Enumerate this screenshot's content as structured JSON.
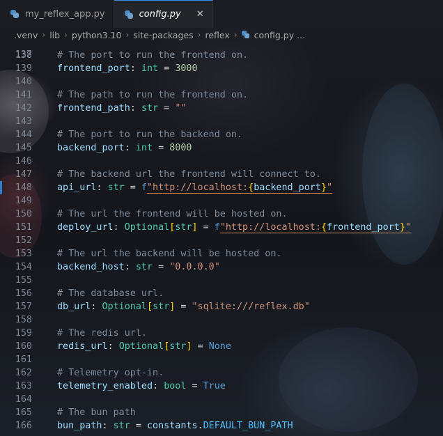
{
  "tabs": [
    {
      "label": "my_reflex_app.py",
      "active": false
    },
    {
      "label": "config.py",
      "active": true,
      "close": "✕"
    }
  ],
  "breadcrumb": {
    "segments": [
      ".venv",
      "lib",
      "python3.10",
      "site-packages",
      "reflex",
      "config.py",
      "..."
    ],
    "separator": "›"
  },
  "editor": {
    "partial_line_number": "137",
    "lines": [
      {
        "n": "138",
        "tokens": [
          {
            "t": "# The port to run the frontend on.",
            "c": "comment"
          }
        ]
      },
      {
        "n": "139",
        "tokens": [
          {
            "t": "frontend_port",
            "c": "var"
          },
          {
            "t": ": ",
            "c": "op"
          },
          {
            "t": "int",
            "c": "type"
          },
          {
            "t": " = ",
            "c": "op"
          },
          {
            "t": "3000",
            "c": "num"
          }
        ]
      },
      {
        "n": "140",
        "tokens": []
      },
      {
        "n": "141",
        "tokens": [
          {
            "t": "# The path to run the frontend on.",
            "c": "comment"
          }
        ]
      },
      {
        "n": "142",
        "tokens": [
          {
            "t": "frontend_path",
            "c": "var"
          },
          {
            "t": ": ",
            "c": "op"
          },
          {
            "t": "str",
            "c": "type"
          },
          {
            "t": " = ",
            "c": "op"
          },
          {
            "t": "\"\"",
            "c": "str"
          }
        ]
      },
      {
        "n": "143",
        "tokens": []
      },
      {
        "n": "144",
        "tokens": [
          {
            "t": "# The port to run the backend on.",
            "c": "comment"
          }
        ]
      },
      {
        "n": "145",
        "tokens": [
          {
            "t": "backend_port",
            "c": "var"
          },
          {
            "t": ": ",
            "c": "op"
          },
          {
            "t": "int",
            "c": "type"
          },
          {
            "t": " = ",
            "c": "op"
          },
          {
            "t": "8000",
            "c": "num"
          }
        ]
      },
      {
        "n": "146",
        "tokens": []
      },
      {
        "n": "147",
        "tokens": [
          {
            "t": "# The backend url the frontend will connect to.",
            "c": "comment"
          }
        ]
      },
      {
        "n": "148",
        "mark": true,
        "tokens": [
          {
            "t": "api_url",
            "c": "var"
          },
          {
            "t": ": ",
            "c": "op"
          },
          {
            "t": "str",
            "c": "type"
          },
          {
            "t": " = ",
            "c": "op"
          },
          {
            "t": "f",
            "c": "f"
          },
          {
            "t": "\"http://localhost:",
            "c": "str ul"
          },
          {
            "t": "{",
            "c": "brk ul"
          },
          {
            "t": "backend_port",
            "c": "var ul"
          },
          {
            "t": "}",
            "c": "brk ul"
          },
          {
            "t": "\"",
            "c": "str ul"
          }
        ]
      },
      {
        "n": "149",
        "tokens": []
      },
      {
        "n": "150",
        "tokens": [
          {
            "t": "# The url the frontend will be hosted on.",
            "c": "comment"
          }
        ]
      },
      {
        "n": "151",
        "tokens": [
          {
            "t": "deploy_url",
            "c": "var"
          },
          {
            "t": ": ",
            "c": "op"
          },
          {
            "t": "Optional",
            "c": "type"
          },
          {
            "t": "[",
            "c": "brk"
          },
          {
            "t": "str",
            "c": "type"
          },
          {
            "t": "]",
            "c": "brk"
          },
          {
            "t": " = ",
            "c": "op"
          },
          {
            "t": "f",
            "c": "f"
          },
          {
            "t": "\"http://localhost:",
            "c": "str ul"
          },
          {
            "t": "{",
            "c": "brk ul"
          },
          {
            "t": "frontend_port",
            "c": "var ul"
          },
          {
            "t": "}",
            "c": "brk ul"
          },
          {
            "t": "\"",
            "c": "str ul"
          }
        ]
      },
      {
        "n": "152",
        "tokens": []
      },
      {
        "n": "153",
        "tokens": [
          {
            "t": "# The url the backend will be hosted on.",
            "c": "comment"
          }
        ]
      },
      {
        "n": "154",
        "tokens": [
          {
            "t": "backend_host",
            "c": "var"
          },
          {
            "t": ": ",
            "c": "op"
          },
          {
            "t": "str",
            "c": "type"
          },
          {
            "t": " = ",
            "c": "op"
          },
          {
            "t": "\"0.0.0.0\"",
            "c": "str"
          }
        ]
      },
      {
        "n": "155",
        "tokens": []
      },
      {
        "n": "156",
        "tokens": [
          {
            "t": "# The database url.",
            "c": "comment"
          }
        ]
      },
      {
        "n": "157",
        "tokens": [
          {
            "t": "db_url",
            "c": "var"
          },
          {
            "t": ": ",
            "c": "op"
          },
          {
            "t": "Optional",
            "c": "type"
          },
          {
            "t": "[",
            "c": "brk"
          },
          {
            "t": "str",
            "c": "type"
          },
          {
            "t": "]",
            "c": "brk"
          },
          {
            "t": " = ",
            "c": "op"
          },
          {
            "t": "\"sqlite:///reflex.db\"",
            "c": "str"
          }
        ]
      },
      {
        "n": "158",
        "tokens": []
      },
      {
        "n": "159",
        "tokens": [
          {
            "t": "# The redis url.",
            "c": "comment"
          }
        ]
      },
      {
        "n": "160",
        "tokens": [
          {
            "t": "redis_url",
            "c": "var"
          },
          {
            "t": ": ",
            "c": "op"
          },
          {
            "t": "Optional",
            "c": "type"
          },
          {
            "t": "[",
            "c": "brk"
          },
          {
            "t": "str",
            "c": "type"
          },
          {
            "t": "]",
            "c": "brk"
          },
          {
            "t": " = ",
            "c": "op"
          },
          {
            "t": "None",
            "c": "kw"
          }
        ]
      },
      {
        "n": "161",
        "tokens": []
      },
      {
        "n": "162",
        "tokens": [
          {
            "t": "# Telemetry opt-in.",
            "c": "comment"
          }
        ]
      },
      {
        "n": "163",
        "tokens": [
          {
            "t": "telemetry_enabled",
            "c": "var"
          },
          {
            "t": ": ",
            "c": "op"
          },
          {
            "t": "bool",
            "c": "type"
          },
          {
            "t": " = ",
            "c": "op"
          },
          {
            "t": "True",
            "c": "kw"
          }
        ]
      },
      {
        "n": "164",
        "tokens": []
      },
      {
        "n": "165",
        "tokens": [
          {
            "t": "# The bun path",
            "c": "comment"
          }
        ]
      },
      {
        "n": "166",
        "tokens": [
          {
            "t": "bun_path",
            "c": "var"
          },
          {
            "t": ": ",
            "c": "op"
          },
          {
            "t": "str",
            "c": "type"
          },
          {
            "t": " = ",
            "c": "op"
          },
          {
            "t": "constants",
            "c": "var"
          },
          {
            "t": ".",
            "c": "op"
          },
          {
            "t": "DEFAULT_BUN_PATH",
            "c": "const"
          }
        ]
      }
    ]
  },
  "colors": {
    "comment": "#7c8a99",
    "variable": "#9cdcfe",
    "type": "#4ec9b0",
    "number": "#b5cea8",
    "string": "#ce9178",
    "keyword": "#569cd6",
    "bracket": "#ffd700",
    "accent": "#3b8eea"
  }
}
